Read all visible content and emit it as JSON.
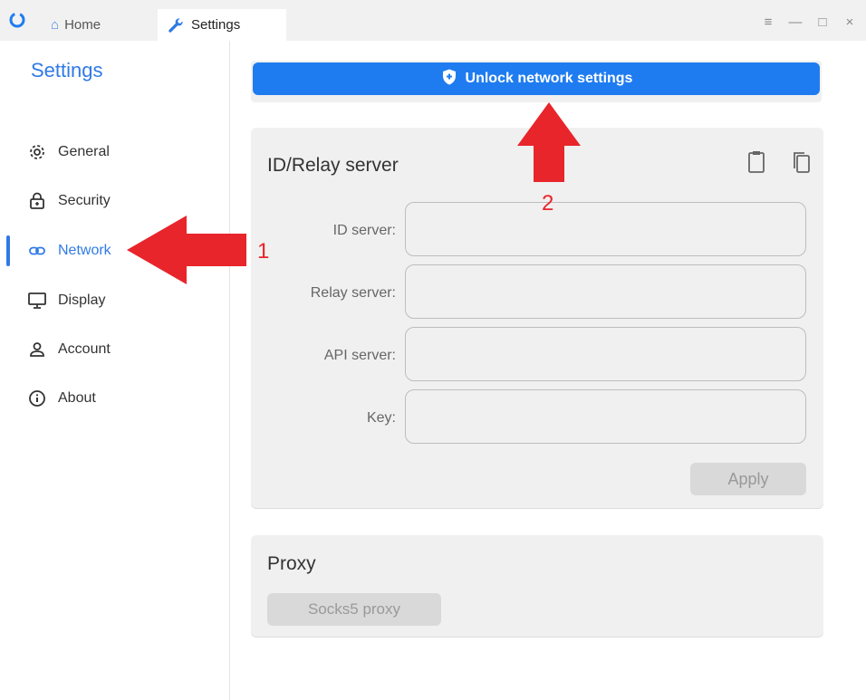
{
  "titlebar": {
    "tabs": [
      {
        "label": "Home",
        "icon": "home-icon"
      },
      {
        "label": "Settings",
        "icon": "wrench-icon"
      }
    ],
    "controls": {
      "menu": "≡",
      "minimize": "—",
      "maximize": "□",
      "close": "×"
    }
  },
  "sidebar": {
    "title": "Settings",
    "items": [
      {
        "label": "General",
        "icon": "gear-icon"
      },
      {
        "label": "Security",
        "icon": "lock-icon"
      },
      {
        "label": "Network",
        "icon": "link-icon",
        "active": true
      },
      {
        "label": "Display",
        "icon": "monitor-icon"
      },
      {
        "label": "Account",
        "icon": "user-icon"
      },
      {
        "label": "About",
        "icon": "info-icon"
      }
    ]
  },
  "main": {
    "unlock_label": "Unlock network settings",
    "id_relay": {
      "title": "ID/Relay server",
      "fields": [
        {
          "label": "ID server:",
          "value": ""
        },
        {
          "label": "Relay server:",
          "value": ""
        },
        {
          "label": "API server:",
          "value": ""
        },
        {
          "label": "Key:",
          "value": ""
        }
      ],
      "apply_label": "Apply"
    },
    "proxy": {
      "title": "Proxy",
      "socks_label": "Socks5 proxy"
    }
  },
  "annotations": {
    "arrow1_number": "1",
    "arrow2_number": "2"
  },
  "colors": {
    "accent": "#2f7ae5",
    "unlock_button": "#1f7cf0",
    "annotation_red": "#e8252b",
    "card_bg": "#f0f0f0"
  }
}
